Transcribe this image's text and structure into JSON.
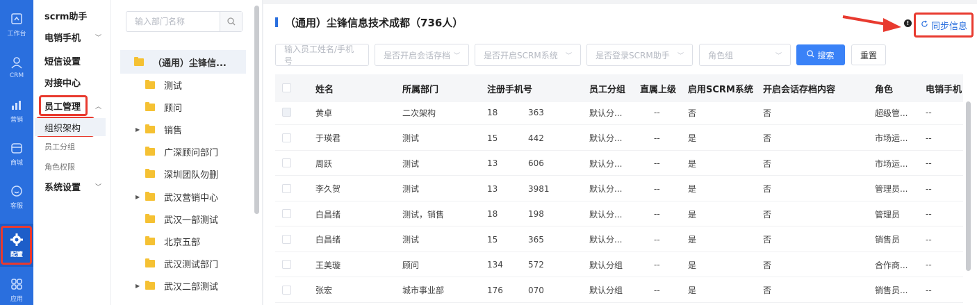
{
  "rail": [
    {
      "label": "工作台",
      "icon": "workbench-icon"
    },
    {
      "label": "CRM",
      "icon": "user-icon"
    },
    {
      "label": "营销",
      "icon": "chart-icon"
    },
    {
      "label": "商城",
      "icon": "shop-icon"
    },
    {
      "label": "客服",
      "icon": "service-icon"
    },
    {
      "label": "配置",
      "icon": "gear-icon"
    },
    {
      "label": "应用",
      "icon": "apps-icon"
    }
  ],
  "menu": {
    "scrm": "scrm助手",
    "phone": "电销手机",
    "sms": "短信设置",
    "connect": "对接中心",
    "staff": "员工管理",
    "org": "组织架构",
    "group": "员工分组",
    "role": "角色权限",
    "settings": "系统设置"
  },
  "dept": {
    "search_placeholder": "输入部门名称",
    "root": "（通用）尘锋信...",
    "items": [
      "测试",
      "顾问",
      "销售",
      "广深顾问部门",
      "深圳团队勿删",
      "武汉营销中心",
      "武汉一部测试",
      "北京五部",
      "武汉测试部门",
      "武汉二部测试"
    ]
  },
  "main": {
    "title": "（通用）尘锋信息技术成都（736人）",
    "sync": "同步信息",
    "filters": {
      "name": "输入员工姓名/手机号",
      "archive": "是否开启会话存档",
      "scrm": "是否开启SCRM系统",
      "login": "是否登录SCRM助手",
      "role": "角色组"
    },
    "search": "搜索",
    "reset": "重置",
    "headers": [
      "姓名",
      "所属部门",
      "注册手机号",
      "员工分组",
      "直属上级",
      "启用SCRM系统",
      "开启会话存档内容",
      "角色",
      "电销手机"
    ],
    "rows": [
      {
        "name": "黄卓",
        "dept": "二次架构",
        "p1": "18",
        "p2": "363",
        "group": "默认分...",
        "boss": "--",
        "scrm": "否",
        "archive": "否",
        "role": "超级管...",
        "phone": "--"
      },
      {
        "name": "于瑛君",
        "dept": "测试",
        "p1": "15",
        "p2": "442",
        "group": "默认分...",
        "boss": "--",
        "scrm": "是",
        "archive": "否",
        "role": "市场运...",
        "phone": "--"
      },
      {
        "name": "周跃",
        "dept": "测试",
        "p1": "13",
        "p2": "606",
        "group": "默认分...",
        "boss": "--",
        "scrm": "是",
        "archive": "否",
        "role": "市场运...",
        "phone": "--"
      },
      {
        "name": "李久贺",
        "dept": "测试",
        "p1": "13",
        "p2": "3981",
        "group": "默认分...",
        "boss": "--",
        "scrm": "是",
        "archive": "否",
        "role": "管理员...",
        "phone": "--"
      },
      {
        "name": "白昌绪",
        "dept": "测试，销售",
        "p1": "18",
        "p2": "198",
        "group": "默认分...",
        "boss": "--",
        "scrm": "是",
        "archive": "否",
        "role": "管理员",
        "phone": "--"
      },
      {
        "name": "白昌绪",
        "dept": "测试",
        "p1": "15",
        "p2": "365",
        "group": "默认分...",
        "boss": "--",
        "scrm": "是",
        "archive": "否",
        "role": "销售员",
        "phone": "--"
      },
      {
        "name": "王美璇",
        "dept": "顾问",
        "p1": "134",
        "p2": "572",
        "group": "默认分组",
        "boss": "--",
        "scrm": "是",
        "archive": "否",
        "role": "合作商...",
        "phone": "--"
      },
      {
        "name": "张宏",
        "dept": "城市事业部",
        "p1": "176",
        "p2": "070",
        "group": "默认分组",
        "boss": "--",
        "scrm": "是",
        "archive": "否",
        "role": "销售员...",
        "phone": "--"
      }
    ]
  }
}
